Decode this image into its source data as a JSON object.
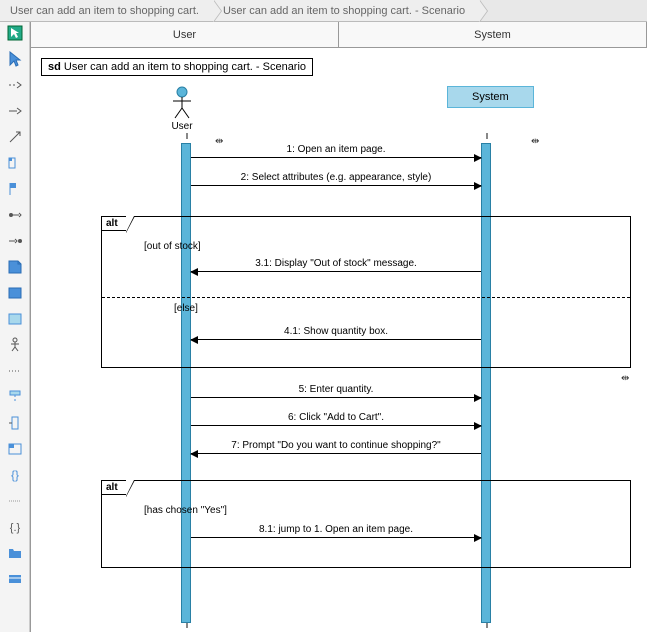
{
  "breadcrumb": {
    "item1": "User can add an item to shopping cart.",
    "item2": "User can add an item to shopping cart. - Scenario"
  },
  "lanes": {
    "user": "User",
    "system": "System"
  },
  "diagram": {
    "title_prefix": "sd",
    "title": "User can add an item to shopping cart. - Scenario",
    "actor_user": "User",
    "actor_system": "System"
  },
  "messages": {
    "m1": "1: Open an item page.",
    "m2": "2: Select attributes (e.g. appearance, style)",
    "m3_1": "3.1: Display \"Out of stock\" message.",
    "m4_1": "4.1: Show quantity box.",
    "m5": "5: Enter quantity.",
    "m6": "6: Click \"Add to Cart\".",
    "m7": "7: Prompt \"Do you want to continue shopping?\"",
    "m8_1": "8.1: jump to 1. Open an item page."
  },
  "alt1": {
    "label": "alt",
    "guard1": "[out of stock]",
    "guard2": "[else]"
  },
  "alt2": {
    "label": "alt",
    "guard1": "[has chosen \"Yes\"]"
  }
}
